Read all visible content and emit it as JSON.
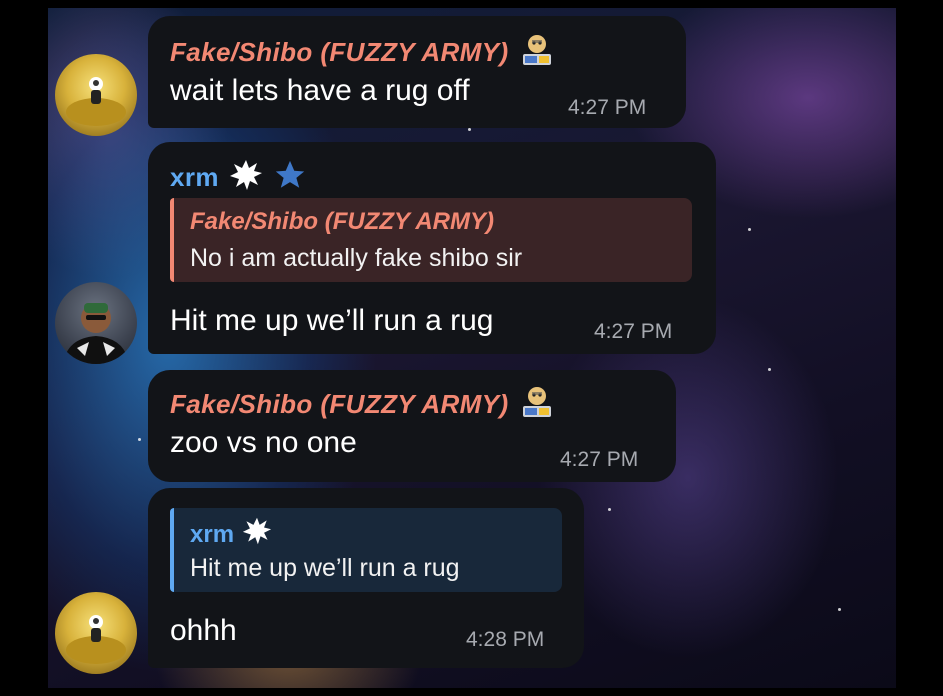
{
  "messages": [
    {
      "sender": "Fake/Shibo (FUZZY ARMY)",
      "text": "wait lets have a rug off",
      "time": "4:27 PM"
    },
    {
      "sender": "xrm",
      "reply": {
        "sender": "Fake/Shibo (FUZZY ARMY)",
        "text": "No i am actually fake shibo sir"
      },
      "text": "Hit me up we’ll run a rug",
      "time": "4:27 PM"
    },
    {
      "sender": "Fake/Shibo (FUZZY ARMY)",
      "text": "zoo vs no one",
      "time": "4:27 PM"
    },
    {
      "reply": {
        "sender": "xrm",
        "text": "Hit me up we’ll run a rug"
      },
      "text": "ohhh",
      "time": "4:28 PM"
    }
  ],
  "colors": {
    "fake_sender": "#f28873",
    "xrm_sender": "#5fa9f2",
    "bubble": "#121418",
    "timestamp": "#a7aab0"
  },
  "icons": {
    "fake_badge": "doge-laptop-sticker",
    "xrm_badge": "white-burst-emoji",
    "xrm_extra": "blue-star-icon",
    "avatar_fake": "gold-bull-avatar",
    "avatar_xrm": "person-avatar"
  }
}
